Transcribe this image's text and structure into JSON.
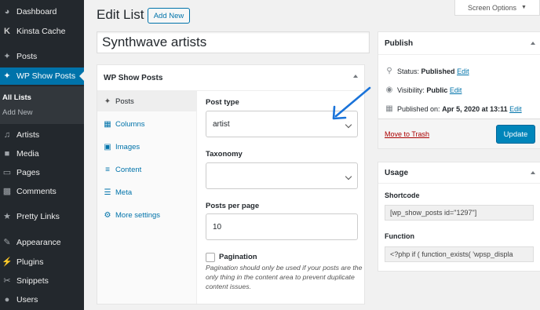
{
  "sidebar": {
    "items": [
      {
        "label": "Dashboard",
        "icon": "dashboard-icon"
      },
      {
        "label": "Kinsta Cache",
        "icon": "kinsta-icon"
      },
      {
        "label": "Posts",
        "icon": "pin-icon"
      },
      {
        "label": "WP Show Posts",
        "icon": "pin-icon"
      },
      {
        "label": "Artists",
        "icon": "music-icon"
      },
      {
        "label": "Media",
        "icon": "media-icon"
      },
      {
        "label": "Pages",
        "icon": "pages-icon"
      },
      {
        "label": "Comments",
        "icon": "comments-icon"
      },
      {
        "label": "Pretty Links",
        "icon": "star-icon"
      },
      {
        "label": "Appearance",
        "icon": "brush-icon"
      },
      {
        "label": "Plugins",
        "icon": "plugin-icon"
      },
      {
        "label": "Snippets",
        "icon": "scissors-icon"
      },
      {
        "label": "Users",
        "icon": "user-icon"
      }
    ],
    "submenu": {
      "all_lists": "All Lists",
      "add_new": "Add New"
    }
  },
  "header": {
    "title": "Edit List",
    "add_new": "Add New",
    "screen_options": "Screen Options"
  },
  "post_title": "Synthwave artists",
  "wpsp_box": {
    "title": "WP Show Posts",
    "tabs": [
      {
        "label": "Posts",
        "icon": "pin-icon"
      },
      {
        "label": "Columns",
        "icon": "columns-icon"
      },
      {
        "label": "Images",
        "icon": "image-icon"
      },
      {
        "label": "Content",
        "icon": "text-icon"
      },
      {
        "label": "Meta",
        "icon": "list-icon"
      },
      {
        "label": "More settings",
        "icon": "gear-icon"
      }
    ],
    "post_type_label": "Post type",
    "post_type_value": "artist",
    "taxonomy_label": "Taxonomy",
    "taxonomy_value": "",
    "posts_per_page_label": "Posts per page",
    "posts_per_page_value": "10",
    "pagination_label": "Pagination",
    "pagination_desc": "Pagination should only be used if your posts are the only thing in the content area to prevent duplicate content issues."
  },
  "publish": {
    "title": "Publish",
    "status_label": "Status:",
    "status_value": "Published",
    "visibility_label": "Visibility:",
    "visibility_value": "Public",
    "published_label": "Published on:",
    "published_value": "Apr 5, 2020 at 13:11",
    "edit": "Edit",
    "trash": "Move to Trash",
    "update": "Update"
  },
  "usage": {
    "title": "Usage",
    "shortcode_label": "Shortcode",
    "shortcode_value": "[wp_show_posts id=\"1297\"]",
    "function_label": "Function",
    "function_value": "<?php if ( function_exists( 'wpsp_displa"
  },
  "colors": {
    "admin_bar": "#23282d",
    "accent": "#0073aa",
    "button": "#0085ba",
    "annotation_arrow": "#1a73d9"
  }
}
